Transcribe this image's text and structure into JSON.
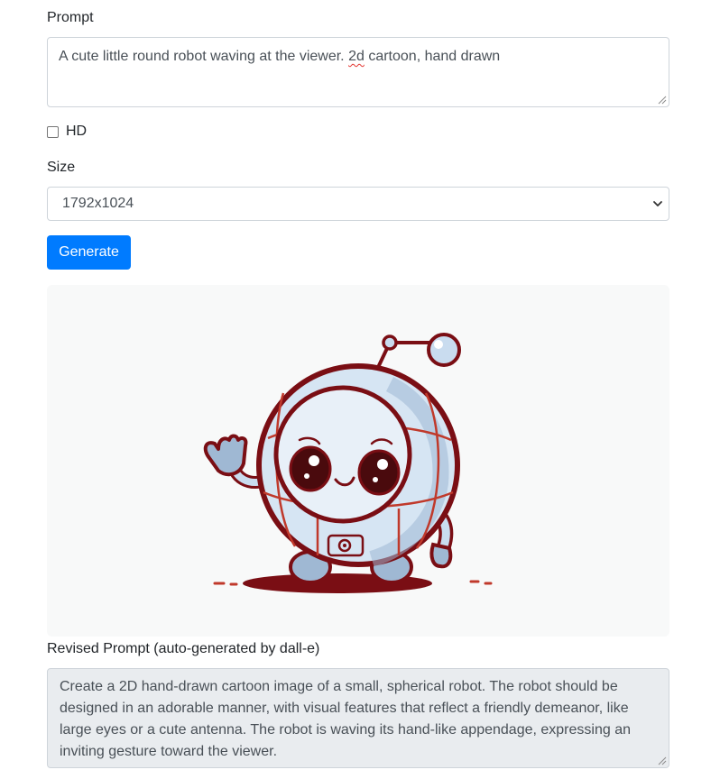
{
  "form": {
    "prompt_label": "Prompt",
    "prompt_value_before": "A cute little round robot waving at the viewer. ",
    "prompt_value_misspelled": "2d",
    "prompt_value_after": " cartoon, hand drawn",
    "hd_label": "HD",
    "hd_checked": false,
    "size_label": "Size",
    "size_selected": "1792x1024",
    "generate_label": "Generate"
  },
  "result": {
    "image_icon": "round-robot-waving-illustration",
    "revised_label": "Revised Prompt (auto-generated by dall-e)",
    "revised_text": "Create a 2D hand-drawn cartoon image of a small, spherical robot. The robot should be designed in an adorable manner, with visual features that reflect a friendly demeanor, like large eyes or a cute antenna. The robot is waving its hand-like appendage, expressing an inviting gesture toward the viewer."
  },
  "colors": {
    "primary": "#007bff",
    "readonly_bg": "#e9ecef",
    "robot_outline": "#7a0e14",
    "robot_body": "#c9dcef"
  }
}
